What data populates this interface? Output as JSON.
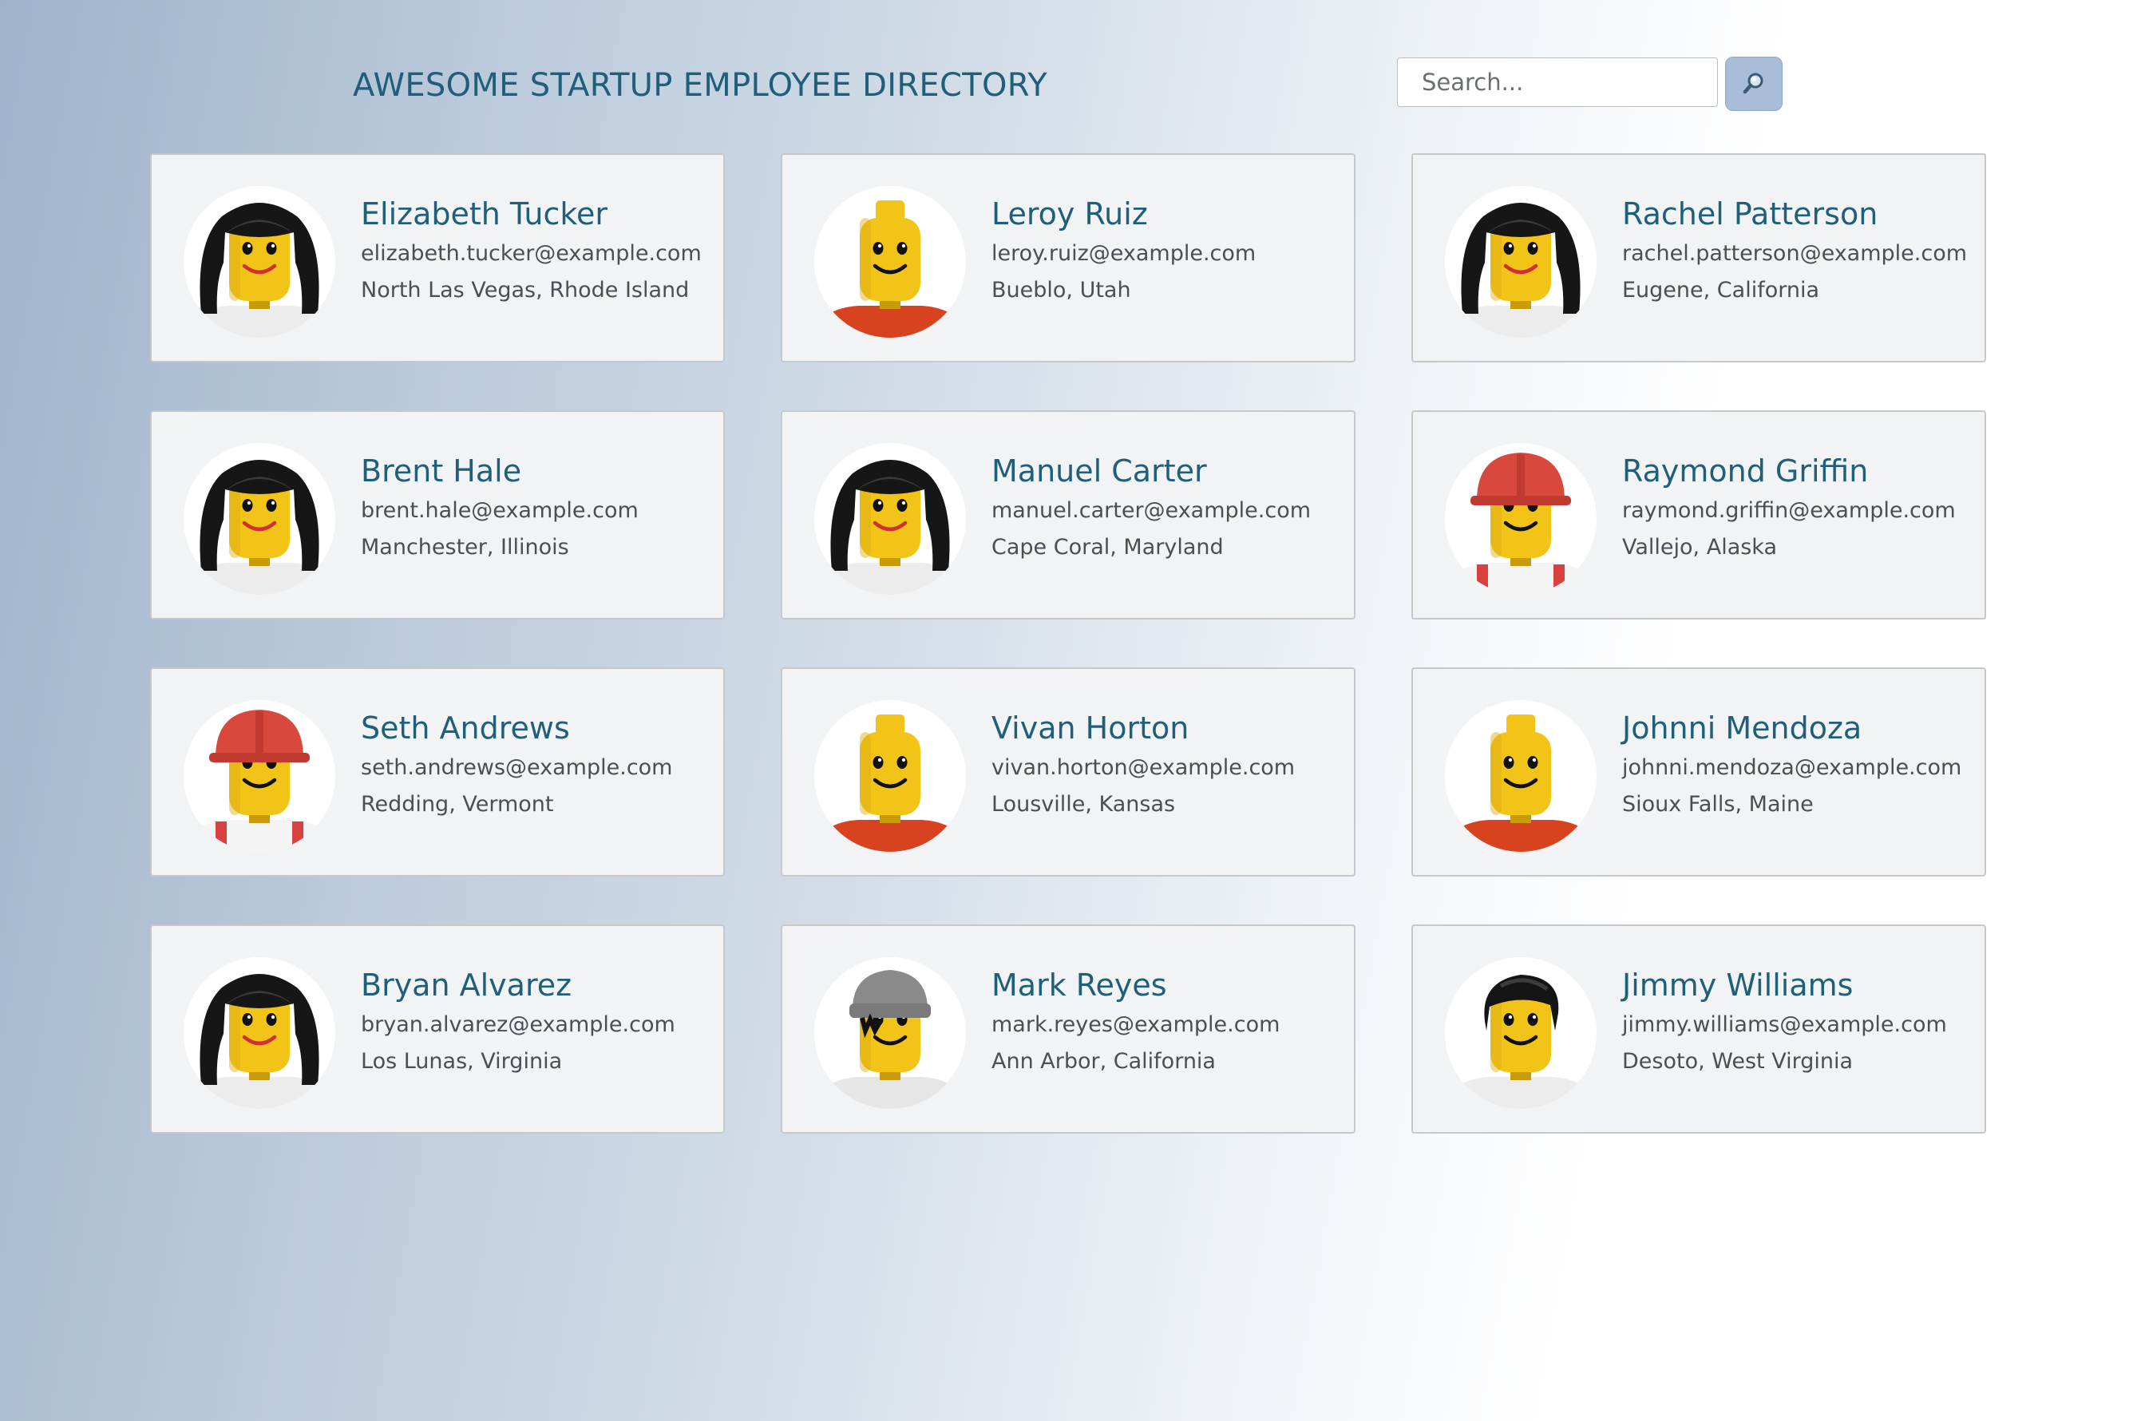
{
  "header": {
    "title": "AWESOME STARTUP EMPLOYEE DIRECTORY"
  },
  "search": {
    "placeholder": "Search...",
    "button_icon": "magnifying-glass-icon"
  },
  "colors": {
    "accent": "#1f5f7a",
    "card_background": "#f2f3f4",
    "search_button": "#a9bdd8"
  },
  "employees": [
    {
      "name": "Elizabeth Tucker",
      "email": "elizabeth.tucker@example.com",
      "location": "North Las Vegas, Rhode Island",
      "avatar": "long-hair-white-shirt"
    },
    {
      "name": "Leroy Ruiz",
      "email": "leroy.ruiz@example.com",
      "location": "Bueblo, Utah",
      "avatar": "bald-red-shirt"
    },
    {
      "name": "Rachel Patterson",
      "email": "rachel.patterson@example.com",
      "location": "Eugene, California",
      "avatar": "long-hair-white-shirt"
    },
    {
      "name": "Brent Hale",
      "email": "brent.hale@example.com",
      "location": "Manchester, Illinois",
      "avatar": "long-hair-white-shirt"
    },
    {
      "name": "Manuel Carter",
      "email": "manuel.carter@example.com",
      "location": "Cape Coral, Maryland",
      "avatar": "long-hair-white-shirt"
    },
    {
      "name": "Raymond Griffin",
      "email": "raymond.griffin@example.com",
      "location": "Vallejo, Alaska",
      "avatar": "hardhat-striped-shirt"
    },
    {
      "name": "Seth Andrews",
      "email": "seth.andrews@example.com",
      "location": "Redding, Vermont",
      "avatar": "hardhat-striped-shirt"
    },
    {
      "name": "Vivan Horton",
      "email": "vivan.horton@example.com",
      "location": "Lousville, Kansas",
      "avatar": "bald-red-shirt"
    },
    {
      "name": "Johnni Mendoza",
      "email": "johnni.mendoza@example.com",
      "location": "Sioux Falls, Maine",
      "avatar": "bald-red-shirt"
    },
    {
      "name": "Bryan Alvarez",
      "email": "bryan.alvarez@example.com",
      "location": "Los Lunas, Virginia",
      "avatar": "long-hair-white-shirt"
    },
    {
      "name": "Mark Reyes",
      "email": "mark.reyes@example.com",
      "location": "Ann Arbor, California",
      "avatar": "gray-beanie-white-shirt"
    },
    {
      "name": "Jimmy Williams",
      "email": "jimmy.williams@example.com",
      "location": "Desoto, West Virginia",
      "avatar": "short-hair-white-shirt"
    }
  ]
}
